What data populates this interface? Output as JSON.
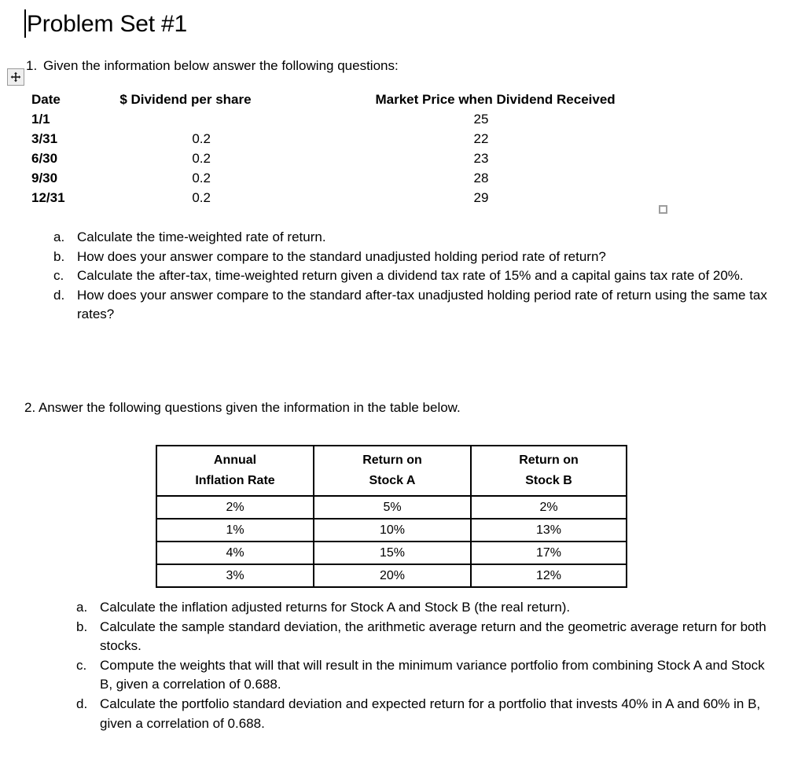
{
  "document": {
    "title": "Problem Set #1"
  },
  "icons": {
    "move_handle": "move-handle-icon",
    "resize_handle": "resize-handle-icon",
    "caret": "text-caret"
  },
  "question1": {
    "number": "1.",
    "prompt": "Given the information below answer the following questions:",
    "table": {
      "headers": [
        "Date",
        "$ Dividend per share",
        "Market Price when Dividend Received"
      ],
      "rows": [
        {
          "date": "1/1",
          "dividend": "",
          "price": "25"
        },
        {
          "date": "3/31",
          "dividend": "0.2",
          "price": "22"
        },
        {
          "date": "6/30",
          "dividend": "0.2",
          "price": "23"
        },
        {
          "date": "9/30",
          "dividend": "0.2",
          "price": "28"
        },
        {
          "date": "12/31",
          "dividend": "0.2",
          "price": "29"
        }
      ]
    },
    "subquestions": [
      {
        "marker": "a.",
        "text": "Calculate the time-weighted rate of return."
      },
      {
        "marker": "b.",
        "text": "How does your answer compare to the standard unadjusted holding period rate of return?"
      },
      {
        "marker": "c.",
        "text": "Calculate the after-tax, time-weighted return given a dividend tax rate of 15% and a capital gains tax rate of 20%."
      },
      {
        "marker": "d.",
        "text": "How does your answer compare to the standard after-tax unadjusted holding period rate of return using the same tax rates?"
      }
    ]
  },
  "question2": {
    "prompt": "2. Answer the following questions given the information in the table below.",
    "table": {
      "headers": [
        {
          "line1": "Annual",
          "line2": "Inflation Rate"
        },
        {
          "line1": "Return on",
          "line2": "Stock A"
        },
        {
          "line1": "Return on",
          "line2": "Stock B"
        }
      ],
      "rows": [
        {
          "inflation": "2%",
          "stock_a": "5%",
          "stock_b": "2%"
        },
        {
          "inflation": "1%",
          "stock_a": "10%",
          "stock_b": "13%"
        },
        {
          "inflation": "4%",
          "stock_a": "15%",
          "stock_b": "17%"
        },
        {
          "inflation": "3%",
          "stock_a": "20%",
          "stock_b": "12%"
        }
      ]
    },
    "subquestions": [
      {
        "marker": "a.",
        "text": "Calculate the inflation adjusted returns for Stock A and Stock B (the real return)."
      },
      {
        "marker": "b.",
        "text": "Calculate the sample standard deviation, the arithmetic average return and the geometric average return for both stocks."
      },
      {
        "marker": "c.",
        "text": "Compute the weights that will that will result in the minimum variance portfolio from combining Stock A and Stock B, given a correlation of 0.688."
      },
      {
        "marker": "d.",
        "text": "Calculate the portfolio standard deviation and expected return for a portfolio that invests 40% in A and 60% in B, given a correlation of 0.688."
      }
    ]
  },
  "colors": {
    "page_background": "#ffffff",
    "text": "#000000",
    "table_border": "#000000",
    "handle_border": "#9a9a9a",
    "handle_fill": "#efefef"
  }
}
